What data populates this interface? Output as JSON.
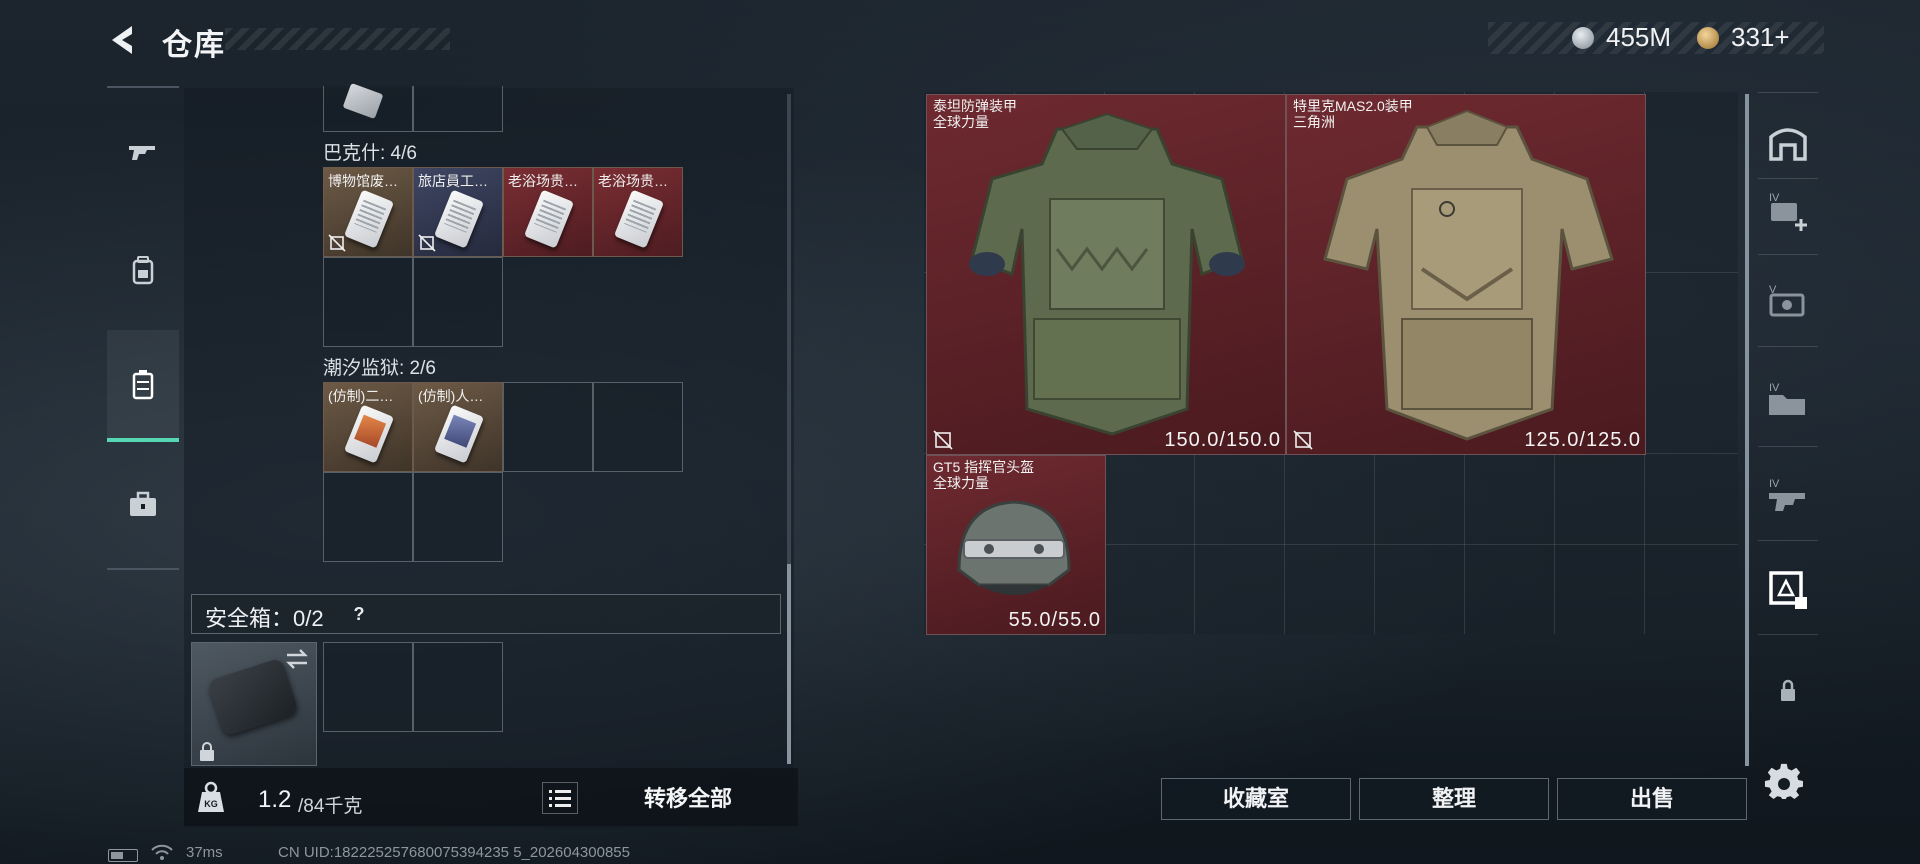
{
  "header": {
    "title": "仓库",
    "silver_amount": "455M",
    "gold_amount": "331+"
  },
  "left_nav": {
    "items": [
      {
        "icon": "gun-icon",
        "active": false
      },
      {
        "icon": "backpack-icon",
        "active": false
      },
      {
        "icon": "container-icon",
        "active": true
      },
      {
        "icon": "toolbox-icon",
        "active": false
      }
    ]
  },
  "groups": [
    {
      "label": "巴克什: 4/6",
      "items": [
        {
          "name": "博物馆废…",
          "bg": "brown"
        },
        {
          "name": "旅店員工…",
          "bg": "navy"
        },
        {
          "name": "老浴场贵…",
          "bg": "red"
        },
        {
          "name": "老浴场贵…",
          "bg": "red"
        }
      ]
    },
    {
      "label": "潮汐监狱: 2/6",
      "items": [
        {
          "name": "(仿制)二…",
          "bg": "brown"
        },
        {
          "name": "(仿制)人…",
          "bg": "brown"
        }
      ]
    }
  ],
  "safebox": {
    "label": "安全箱：0/2",
    "help": "?"
  },
  "weight": {
    "current": "1.2",
    "max": "/84千克"
  },
  "transfer_all": "转移全部",
  "status": {
    "ping": "37ms",
    "uid": "CN UID:182225257680075394235 5_202604300855"
  },
  "equipment": [
    {
      "name": "泰坦防弹装甲",
      "sub": "全球力量",
      "durability": "150.0/150.0",
      "icon": "armor-vest-icon"
    },
    {
      "name": "特里克MAS2.0装甲",
      "sub": "三角洲",
      "durability": "125.0/125.0",
      "icon": "armor-vest-camo-icon"
    },
    {
      "name": "GT5 指挥官头盔",
      "sub": "全球力量",
      "durability": "55.0/55.0",
      "icon": "helmet-icon"
    }
  ],
  "buttons": {
    "collection": "收藏室",
    "sort": "整理",
    "sell": "出售"
  },
  "right_nav": {
    "items": [
      "storage-tab-icon",
      "tab-iv-add-icon",
      "tab-v-gear-icon",
      "tab-iv-folder-icon",
      "tab-iv-gun-icon",
      "tab-filter-icon",
      "lock-icon"
    ]
  },
  "colors": {
    "accent": "#56d6b2",
    "tile_red": "#6e2a30",
    "tile_brown": "#6d5a46",
    "tile_navy": "#3f4663"
  }
}
